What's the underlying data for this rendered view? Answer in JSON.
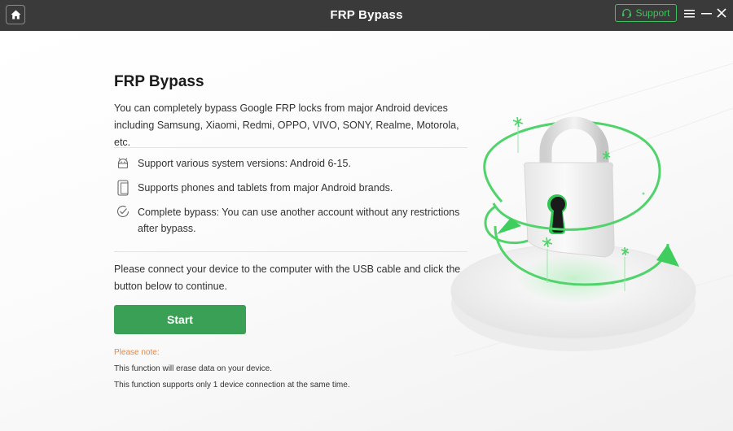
{
  "window": {
    "title": "FRP Bypass",
    "support_label": "Support"
  },
  "main": {
    "heading": "FRP Bypass",
    "description": "You can completely bypass Google FRP locks from major Android devices including Samsung, Xiaomi, Redmi, OPPO, VIVO, SONY, Realme, Motorola, etc.",
    "features": [
      {
        "icon": "android-icon",
        "text": "Support various system versions: Android 6-15."
      },
      {
        "icon": "tablet-icon",
        "text": "Supports phones and tablets from major Android brands."
      },
      {
        "icon": "check-circle-icon",
        "text": "Complete bypass: You can use another account without any restrictions after bypass."
      }
    ],
    "instruction": "Please connect your device to the computer with the USB cable and click the button below to continue.",
    "start_label": "Start",
    "note": {
      "title": "Please note:",
      "lines": [
        "This function will erase data on your device.",
        "This function supports only 1 device connection at the same time."
      ]
    }
  },
  "colors": {
    "titlebar": "#3a3a3a",
    "accent_green": "#3aa055",
    "support_green": "#3fc25d",
    "note_orange": "#f0833a"
  }
}
